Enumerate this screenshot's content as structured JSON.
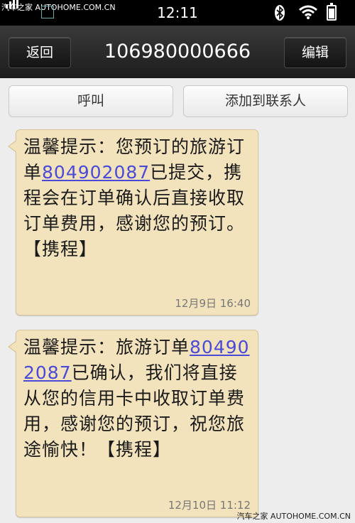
{
  "status_bar": {
    "watermark": "汽车之家 AUTOHOME.COM.CN",
    "time": "12:11",
    "icons": [
      "signal-icon",
      "picture-icon",
      "bluetooth-icon",
      "wifi-icon",
      "battery-icon"
    ]
  },
  "title_bar": {
    "back_label": "返回",
    "contact": "106980000666",
    "edit_label": "编辑"
  },
  "action_bar": {
    "call_label": "呼叫",
    "add_contact_label": "添加到联系人"
  },
  "messages": [
    {
      "text_before": "温馨提示：您预订的旅游订单",
      "order_number": "804902087",
      "text_after": "已提交，携程会在订单确认后直接收取订单费用，感谢您的预订。【携程】",
      "time": "12月9日 16:40"
    },
    {
      "text_before": "温馨提示：旅游订单",
      "order_number": "804902087",
      "text_after": "已确认，我们将直接从您的信用卡中收取订单费用，感谢您的预订，祝您旅途愉快！【携程】",
      "time": "12月10日 11:12"
    }
  ],
  "watermark_bottom": "汽车之家 AUTOHOME.COM.CN",
  "colors": {
    "bubble_bg": "#f3e3bd",
    "link": "#4a4ad8",
    "title_bg": "#2a2a2a"
  }
}
